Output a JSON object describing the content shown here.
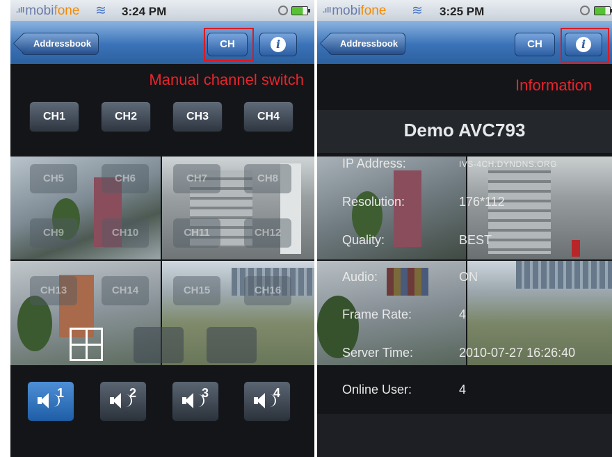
{
  "left": {
    "status": {
      "carrier_main": "mobi",
      "carrier_accent": "fone",
      "time": "3:24 PM"
    },
    "nav": {
      "back_label": "Addressbook",
      "ch_label": "CH",
      "info_label": "i"
    },
    "annotation": "Manual channel switch",
    "channel_buttons": [
      "CH1",
      "CH2",
      "CH3",
      "CH4"
    ],
    "overlay_channels": [
      "CH5",
      "CH6",
      "CH7",
      "CH8",
      "CH9",
      "CH10",
      "CH11",
      "CH12",
      "CH13",
      "CH14",
      "CH15",
      "CH16"
    ],
    "speakers": [
      {
        "num": "1",
        "active": true
      },
      {
        "num": "2",
        "active": false
      },
      {
        "num": "3",
        "active": false
      },
      {
        "num": "4",
        "active": false
      }
    ]
  },
  "right": {
    "status": {
      "carrier_main": "mobi",
      "carrier_accent": "fone",
      "time": "3:25 PM"
    },
    "nav": {
      "back_label": "Addressbook",
      "ch_label": "CH",
      "info_label": "i"
    },
    "annotation": "Information",
    "device_name": "Demo AVC793",
    "info": [
      {
        "key": "IP Address:",
        "value": "IVS-4CH.DYNDNS.ORG"
      },
      {
        "key": "Resolution:",
        "value": "176*112"
      },
      {
        "key": "Quality:",
        "value": "BEST"
      },
      {
        "key": "Audio:",
        "value": "ON"
      },
      {
        "key": "Frame Rate:",
        "value": "4"
      },
      {
        "key": "Server Time:",
        "value": "2010-07-27 16:26:40"
      },
      {
        "key": "Online User:",
        "value": "4"
      }
    ]
  },
  "colors": {
    "highlight": "#d81c25",
    "annotation": "#e8242c",
    "nav_blue": "#3b73b8",
    "carrier_orange": "#f28a00"
  }
}
